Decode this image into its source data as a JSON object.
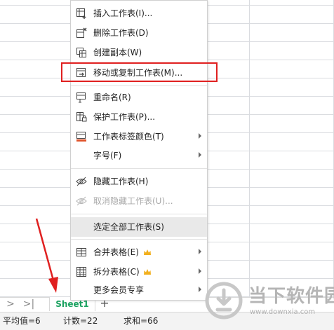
{
  "context_menu": {
    "items": [
      {
        "label": "插入工作表(I)...",
        "icon": "insert-sheet-icon"
      },
      {
        "label": "删除工作表(D)",
        "icon": "delete-sheet-icon"
      },
      {
        "label": "创建副本(W)",
        "icon": "copy-sheet-icon"
      },
      {
        "label": "移动或复制工作表(M)...",
        "icon": "move-copy-sheet-icon"
      },
      {
        "label": "重命名(R)",
        "icon": "rename-icon"
      },
      {
        "label": "保护工作表(P)...",
        "icon": "protect-sheet-icon"
      },
      {
        "label": "工作表标签颜色(T)",
        "icon": "tab-color-icon"
      },
      {
        "label": "字号(F)",
        "icon": ""
      },
      {
        "label": "隐藏工作表(H)",
        "icon": "hide-eye-icon"
      },
      {
        "label": "取消隐藏工作表(U)...",
        "icon": "unhide-eye-icon"
      },
      {
        "label": "选定全部工作表(S)",
        "icon": ""
      },
      {
        "label": "合并表格(E)",
        "icon": "merge-table-icon"
      },
      {
        "label": "拆分表格(C)",
        "icon": "split-table-icon"
      },
      {
        "label": "更多会员专享",
        "icon": ""
      }
    ]
  },
  "sheet_tabs": {
    "active_tab": "Sheet1",
    "add_tab": "+",
    "nav_next": ">",
    "nav_last": ">|"
  },
  "status_bar": {
    "average": "平均值=6",
    "count": "计数=22",
    "sum": "求和=66"
  },
  "watermark": {
    "name": "当下软件园",
    "url": "www.downxia.com"
  },
  "colors": {
    "highlight_box": "#e02020",
    "annotation_arrow": "#e02020",
    "active_tab_text": "#1aa260",
    "crown": "#f2b01e"
  }
}
